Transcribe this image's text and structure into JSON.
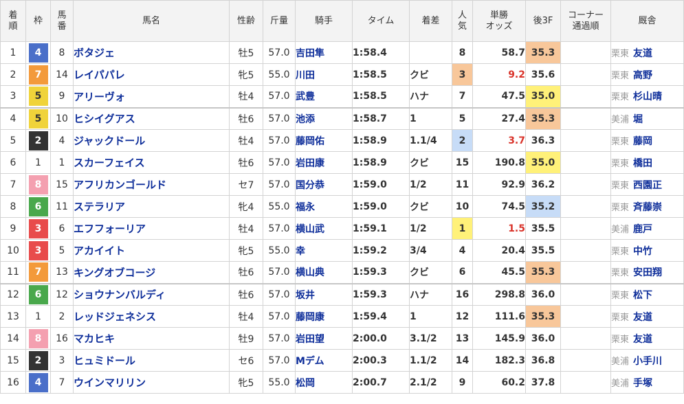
{
  "colors": {
    "waku": {
      "1": {
        "bg": "#ffffff",
        "fg": "#333333"
      },
      "2": {
        "bg": "#333333",
        "fg": "#ffffff"
      },
      "3": {
        "bg": "#e84b4b",
        "fg": "#ffffff"
      },
      "4": {
        "bg": "#4a6fc9",
        "fg": "#ffffff"
      },
      "5": {
        "bg": "#f0d33a",
        "fg": "#333333"
      },
      "6": {
        "bg": "#49a84c",
        "fg": "#ffffff"
      },
      "7": {
        "bg": "#f39a3b",
        "fg": "#ffffff"
      },
      "8": {
        "bg": "#f4a0b0",
        "fg": "#ffffff"
      }
    },
    "rank": {
      "1": "#fff179",
      "2": "#c7dcf7",
      "3": "#f8c79a"
    },
    "favorite_odds": "#d9342b",
    "link": "#0e2e9a"
  },
  "headers": {
    "pos": [
      "着",
      "順"
    ],
    "waku": "枠",
    "num": [
      "馬",
      "番"
    ],
    "horse": "馬名",
    "sexage": "性齢",
    "weight": "斤量",
    "jockey": "騎手",
    "time": "タイム",
    "margin": "着差",
    "pop": [
      "人",
      "気"
    ],
    "odds": [
      "単勝",
      "オッズ"
    ],
    "last3f": "後3F",
    "corner": [
      "コーナー",
      "通過順"
    ],
    "stable": "厩舎"
  },
  "rows": [
    {
      "pos": "1",
      "waku": "4",
      "num": "8",
      "horse": "ボタジェ",
      "sexage": "牡5",
      "weight": "57.0",
      "jockey": "吉田隼",
      "time": "1:58.4",
      "margin": "",
      "pop": "8",
      "pop_rank": 0,
      "odds": "58.7",
      "last3f": "35.3",
      "last3f_rank": 3,
      "corner": "",
      "region": "栗東",
      "trainer": "友道"
    },
    {
      "pos": "2",
      "waku": "7",
      "num": "14",
      "horse": "レイパパレ",
      "sexage": "牝5",
      "weight": "55.0",
      "jockey": "川田",
      "time": "1:58.5",
      "margin": "クビ",
      "pop": "3",
      "pop_rank": 3,
      "odds": "9.2",
      "last3f": "35.6",
      "last3f_rank": 0,
      "corner": "",
      "region": "栗東",
      "trainer": "高野"
    },
    {
      "pos": "3",
      "waku": "5",
      "num": "9",
      "horse": "アリーヴォ",
      "sexage": "牡4",
      "weight": "57.0",
      "jockey": "武豊",
      "time": "1:58.5",
      "margin": "ハナ",
      "pop": "7",
      "pop_rank": 0,
      "odds": "47.5",
      "last3f": "35.0",
      "last3f_rank": 1,
      "corner": "",
      "region": "栗東",
      "trainer": "杉山晴"
    },
    {
      "pos": "4",
      "waku": "5",
      "num": "10",
      "horse": "ヒシイグアス",
      "sexage": "牡6",
      "weight": "57.0",
      "jockey": "池添",
      "time": "1:58.7",
      "margin": "1",
      "pop": "5",
      "pop_rank": 0,
      "odds": "27.4",
      "last3f": "35.3",
      "last3f_rank": 3,
      "corner": "",
      "region": "美浦",
      "trainer": "堀"
    },
    {
      "pos": "5",
      "waku": "2",
      "num": "4",
      "horse": "ジャックドール",
      "sexage": "牡4",
      "weight": "57.0",
      "jockey": "藤岡佑",
      "time": "1:58.9",
      "margin": "1.1/4",
      "pop": "2",
      "pop_rank": 2,
      "odds": "3.7",
      "last3f": "36.3",
      "last3f_rank": 0,
      "corner": "",
      "region": "栗東",
      "trainer": "藤岡"
    },
    {
      "pos": "6",
      "waku": "1",
      "num": "1",
      "horse": "スカーフェイス",
      "sexage": "牡6",
      "weight": "57.0",
      "jockey": "岩田康",
      "time": "1:58.9",
      "margin": "クビ",
      "pop": "15",
      "pop_rank": 0,
      "odds": "190.8",
      "last3f": "35.0",
      "last3f_rank": 1,
      "corner": "",
      "region": "栗東",
      "trainer": "橋田"
    },
    {
      "pos": "7",
      "waku": "8",
      "num": "15",
      "horse": "アフリカンゴールド",
      "sexage": "セ7",
      "weight": "57.0",
      "jockey": "国分恭",
      "time": "1:59.0",
      "margin": "1/2",
      "pop": "11",
      "pop_rank": 0,
      "odds": "92.9",
      "last3f": "36.2",
      "last3f_rank": 0,
      "corner": "",
      "region": "栗東",
      "trainer": "西園正"
    },
    {
      "pos": "8",
      "waku": "6",
      "num": "11",
      "horse": "ステラリア",
      "sexage": "牝4",
      "weight": "55.0",
      "jockey": "福永",
      "time": "1:59.0",
      "margin": "クビ",
      "pop": "10",
      "pop_rank": 0,
      "odds": "74.5",
      "last3f": "35.2",
      "last3f_rank": 2,
      "corner": "",
      "region": "栗東",
      "trainer": "斉藤崇"
    },
    {
      "pos": "9",
      "waku": "3",
      "num": "6",
      "horse": "エフフォーリア",
      "sexage": "牡4",
      "weight": "57.0",
      "jockey": "横山武",
      "time": "1:59.1",
      "margin": "1/2",
      "pop": "1",
      "pop_rank": 1,
      "odds": "1.5",
      "last3f": "35.5",
      "last3f_rank": 0,
      "corner": "",
      "region": "美浦",
      "trainer": "鹿戸"
    },
    {
      "pos": "10",
      "waku": "3",
      "num": "5",
      "horse": "アカイイト",
      "sexage": "牝5",
      "weight": "55.0",
      "jockey": "幸",
      "time": "1:59.2",
      "margin": "3/4",
      "pop": "4",
      "pop_rank": 0,
      "odds": "20.4",
      "last3f": "35.5",
      "last3f_rank": 0,
      "corner": "",
      "region": "栗東",
      "trainer": "中竹"
    },
    {
      "pos": "11",
      "waku": "7",
      "num": "13",
      "horse": "キングオブコージ",
      "sexage": "牡6",
      "weight": "57.0",
      "jockey": "横山典",
      "time": "1:59.3",
      "margin": "クビ",
      "pop": "6",
      "pop_rank": 0,
      "odds": "45.5",
      "last3f": "35.3",
      "last3f_rank": 3,
      "corner": "",
      "region": "栗東",
      "trainer": "安田翔"
    },
    {
      "pos": "12",
      "waku": "6",
      "num": "12",
      "horse": "ショウナンバルディ",
      "sexage": "牡6",
      "weight": "57.0",
      "jockey": "坂井",
      "time": "1:59.3",
      "margin": "ハナ",
      "pop": "16",
      "pop_rank": 0,
      "odds": "298.8",
      "last3f": "36.0",
      "last3f_rank": 0,
      "corner": "",
      "region": "栗東",
      "trainer": "松下"
    },
    {
      "pos": "13",
      "waku": "1",
      "num": "2",
      "horse": "レッドジェネシス",
      "sexage": "牡4",
      "weight": "57.0",
      "jockey": "藤岡康",
      "time": "1:59.4",
      "margin": "1",
      "pop": "12",
      "pop_rank": 0,
      "odds": "111.6",
      "last3f": "35.3",
      "last3f_rank": 3,
      "corner": "",
      "region": "栗東",
      "trainer": "友道"
    },
    {
      "pos": "14",
      "waku": "8",
      "num": "16",
      "horse": "マカヒキ",
      "sexage": "牡9",
      "weight": "57.0",
      "jockey": "岩田望",
      "time": "2:00.0",
      "margin": "3.1/2",
      "pop": "13",
      "pop_rank": 0,
      "odds": "145.9",
      "last3f": "36.0",
      "last3f_rank": 0,
      "corner": "",
      "region": "栗東",
      "trainer": "友道"
    },
    {
      "pos": "15",
      "waku": "2",
      "num": "3",
      "horse": "ヒュミドール",
      "sexage": "セ6",
      "weight": "57.0",
      "jockey": "Mデム",
      "time": "2:00.3",
      "margin": "1.1/2",
      "pop": "14",
      "pop_rank": 0,
      "odds": "182.3",
      "last3f": "36.8",
      "last3f_rank": 0,
      "corner": "",
      "region": "美浦",
      "trainer": "小手川"
    },
    {
      "pos": "16",
      "waku": "4",
      "num": "7",
      "horse": "ウインマリリン",
      "sexage": "牝5",
      "weight": "55.0",
      "jockey": "松岡",
      "time": "2:00.7",
      "margin": "2.1/2",
      "pop": "9",
      "pop_rank": 0,
      "odds": "60.2",
      "last3f": "37.8",
      "last3f_rank": 0,
      "corner": "",
      "region": "美浦",
      "trainer": "手塚"
    }
  ]
}
